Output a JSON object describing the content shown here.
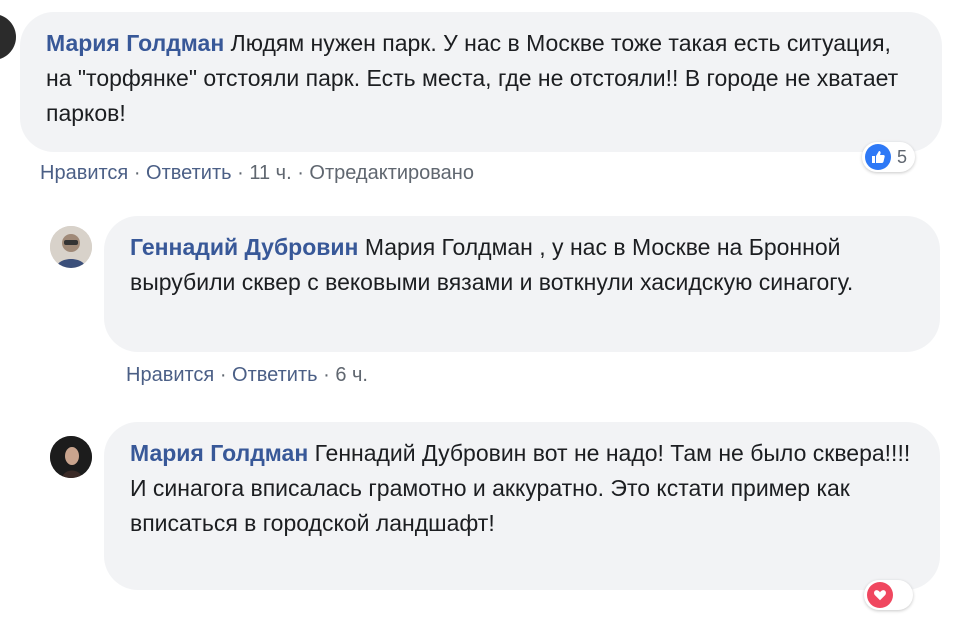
{
  "comments": [
    {
      "author": "Мария Голдман",
      "text": "Людям нужен парк. У нас в Москве тоже такая есть ситуация, на \"торфянке\" отстояли парк. Есть места, где не отстояли!! В городе не хватает парков!",
      "like": "Нравится",
      "reply": "Ответить",
      "time": "11 ч.",
      "edited": "Отредактировано",
      "reaction_count": "5",
      "reaction_icon": "like-icon"
    },
    {
      "author": "Геннадий Дубровин",
      "text": "Мария Голдман , у нас в Москве на Бронной вырубили сквер с вековыми вязами и воткнули хасидскую синагогу.",
      "like": "Нравится",
      "reply": "Ответить",
      "time": "6 ч."
    },
    {
      "author": "Мария Голдман",
      "text": "Геннадий Дубровин вот не надо! Там не было сквера!!!!И синагога вписалась грамотно и аккуратно. Это кстати пример как вписаться в городской ландшафт!",
      "reaction_icon": "heart-icon"
    }
  ],
  "colors": {
    "author": "#385898",
    "bubble": "#f2f3f5",
    "meta": "#606770",
    "like_badge": "#2e79f6",
    "heart_badge": "#f0475f"
  }
}
